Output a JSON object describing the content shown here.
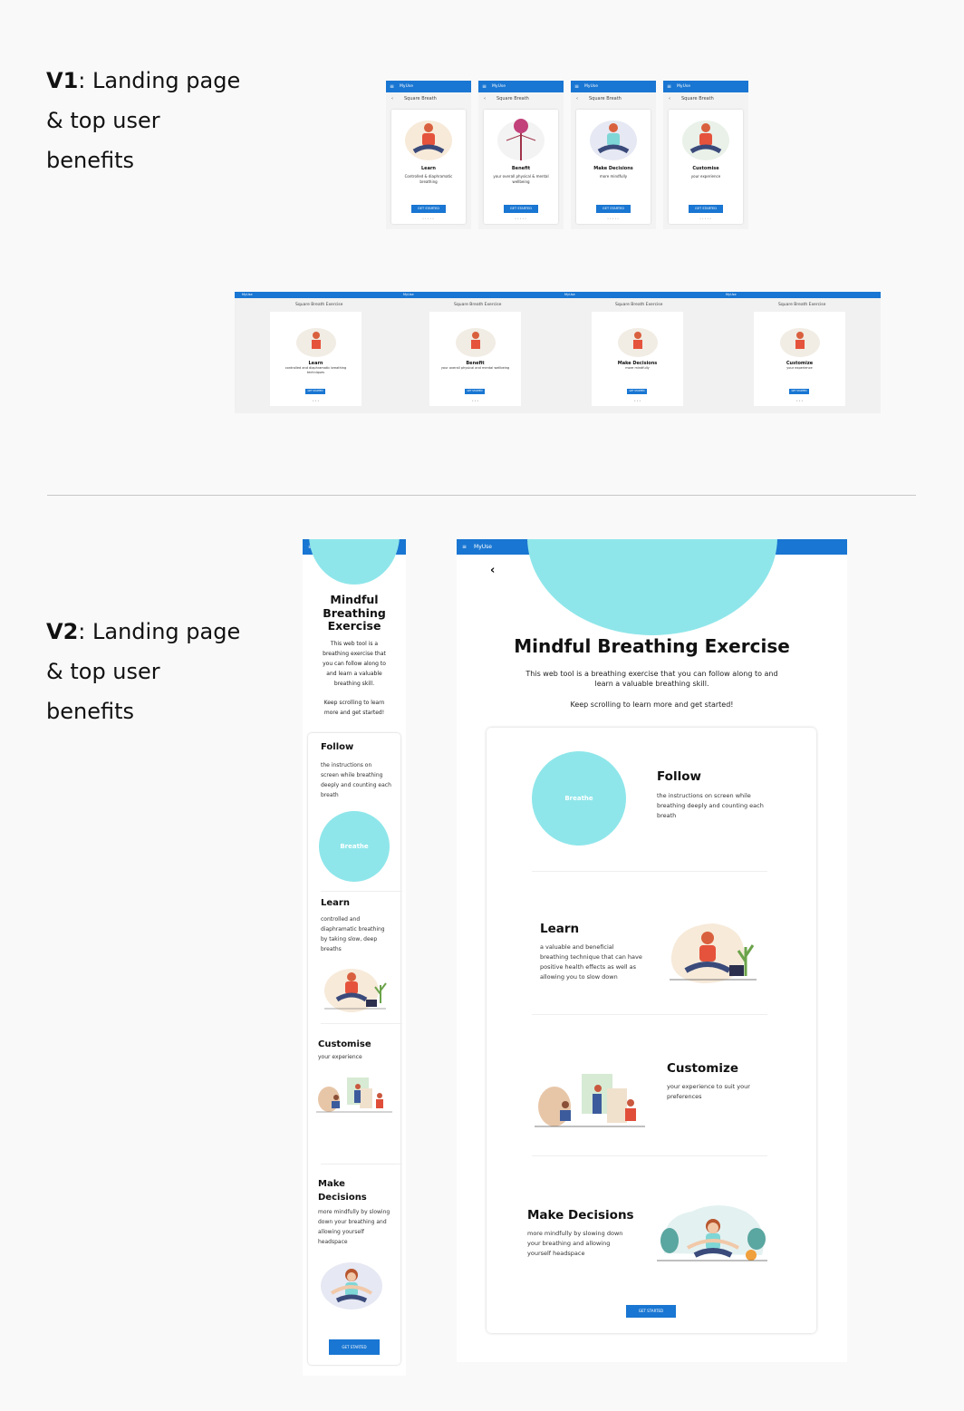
{
  "v1": {
    "heading_bold": "V1",
    "heading_rest": ": Landing page",
    "heading_line2": "& top user",
    "heading_line3": "benefits",
    "app_title": "MyUse",
    "subtitle": "Square Breath",
    "button": "GET STARTED",
    "cards": [
      {
        "title": "Learn",
        "text": "Controlled & diaphramatic breathing"
      },
      {
        "title": "Benefit",
        "text": "your overall physical & mental wellbeing"
      },
      {
        "title": "Make Decisions",
        "text": "more mindfully"
      },
      {
        "title": "Customise",
        "text": "your experience"
      }
    ],
    "wide": {
      "subtitle": "Square Breath Exercise",
      "app_label": "MyUse",
      "cards": [
        {
          "title": "Learn",
          "text": "controlled and diaphramatic breathing techniques"
        },
        {
          "title": "Benefit",
          "text": "your overall physical and mental wellbeing"
        },
        {
          "title": "Make Decisions",
          "text": "more mindfully"
        },
        {
          "title": "Customize",
          "text": "your experience"
        }
      ],
      "button": "GET STARTED"
    }
  },
  "v2": {
    "heading_bold": "V2",
    "heading_rest": ": Landing page",
    "heading_line2": "& top user",
    "heading_line3": "benefits",
    "app_title": "MyUse",
    "title": "Mindful Breathing Exercise",
    "intro": "This web tool is a breathing exercise that you can follow along to and learn a valuable breathing skill.",
    "keep": "Keep scrolling to learn more and get started!",
    "breathe": "Breathe",
    "button": "GET STARTED",
    "mobile": {
      "title_l1": "Mindful",
      "title_l2": "Breathing",
      "title_l3": "Exercise",
      "sections": [
        {
          "title": "Follow",
          "text": "the instructions on screen while breathing deeply and counting each breath"
        },
        {
          "title": "Learn",
          "text": "controlled and diaphramatic breathing by taking slow, deep breaths"
        },
        {
          "title": "Customise",
          "text": "your experience"
        },
        {
          "title": "Make Decisions",
          "text": "more mindfully by slowing down your breathing and allowing yourself headspace"
        }
      ]
    },
    "desktop": {
      "sections": [
        {
          "title": "Follow",
          "text": "the instructions on screen while breathing deeply and counting each breath"
        },
        {
          "title": "Learn",
          "text": "a valuable and beneficial breathing technique that can have positive health effects as well as allowing you to slow down"
        },
        {
          "title": "Customize",
          "text": "your experience to suit your preferences"
        },
        {
          "title": "Make Decisions",
          "text": "more mindfully by slowing down your breathing and allowing yourself headspace"
        }
      ]
    }
  },
  "colors": {
    "primary": "#1976d2",
    "breathe": "#8ee6ea",
    "background": "#f9f9f9"
  },
  "icons": [
    "menu-icon",
    "back-chevron-icon"
  ]
}
